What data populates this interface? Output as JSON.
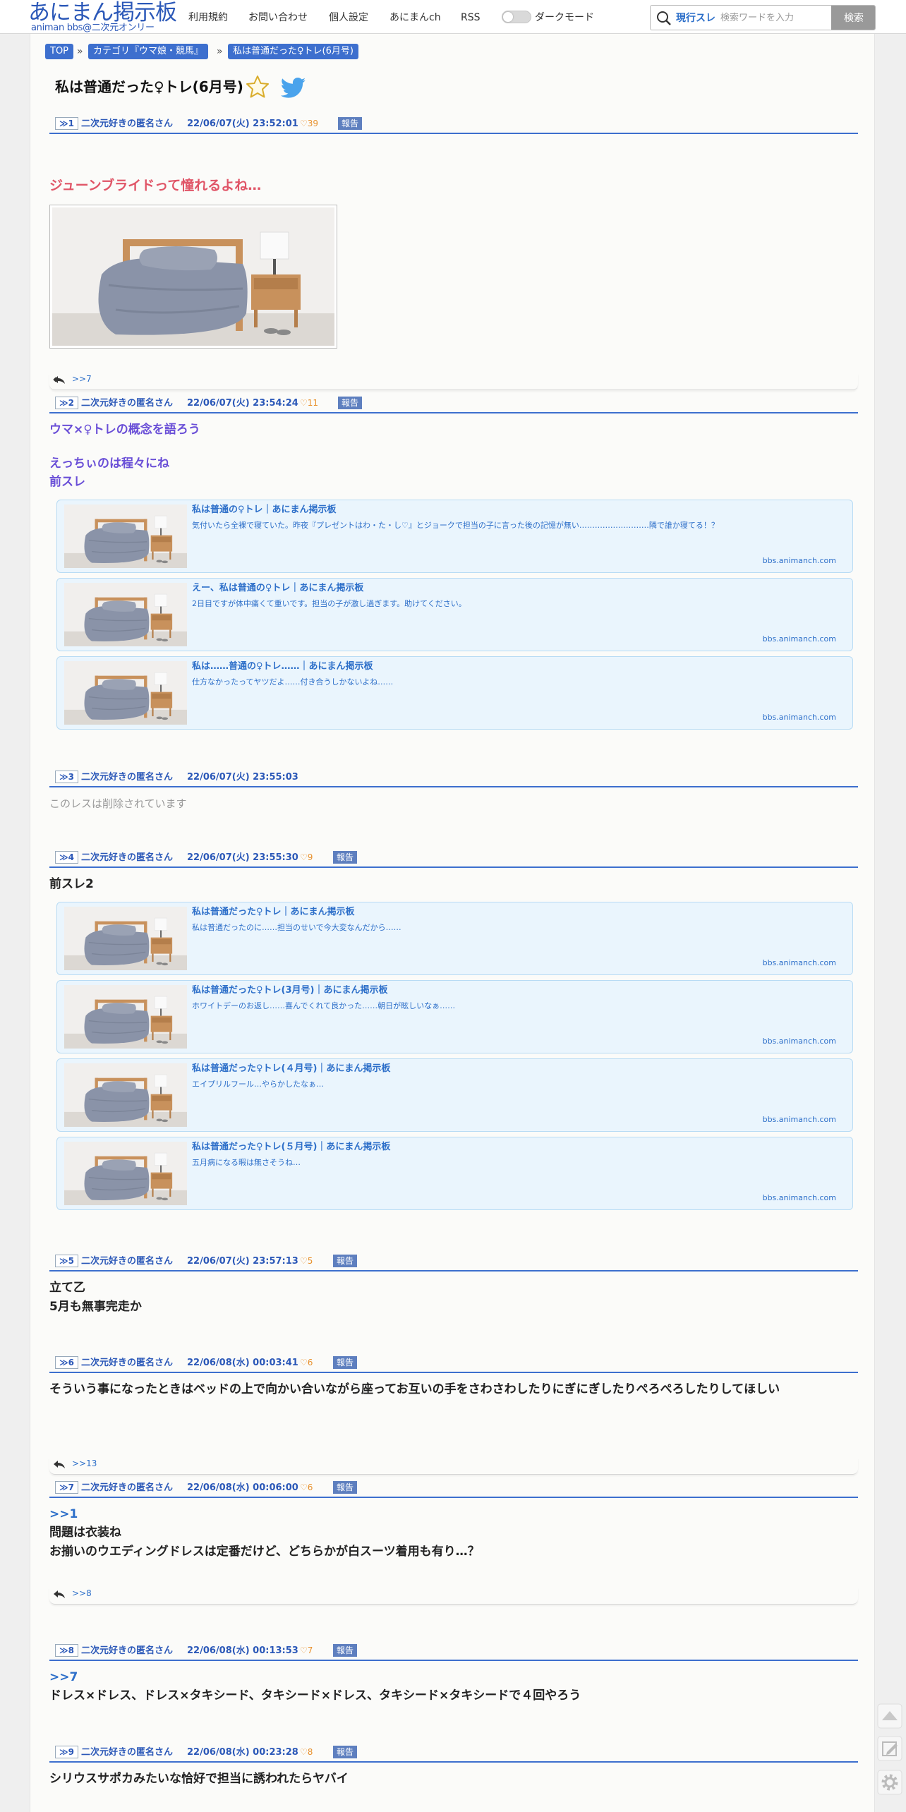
{
  "header": {
    "logo_main": "あにまん掲示板",
    "logo_sub": "animan bbs@二次元オンリー",
    "nav": [
      "利用規約",
      "お問い合わせ",
      "個人設定",
      "あにまんch",
      "RSS"
    ],
    "dark_mode_label": "ダークモード",
    "search_scope": "現行スレ",
    "search_placeholder": "検索ワードを入力",
    "search_button": "検索"
  },
  "breadcrumb": {
    "top": "TOP",
    "category": "カテゴリ『ウマ娘・競馬』",
    "thread": "私は普通だった♀トレ(6月号)",
    "separator": "»"
  },
  "thread_title": "私は普通だった♀トレ(6月号)",
  "colors": {
    "accent": "#3d6fce",
    "link": "#2d6fc9",
    "red": "#e05567",
    "purple": "#6a4fd7",
    "like": "#e8912d"
  },
  "report_label": "報告",
  "posts": [
    {
      "num": "≫1",
      "name": "二次元好きの匿名さん",
      "date": "22/06/07(火) 23:52:01",
      "likes": "39",
      "lines": [
        "ジューンブライドって憧れるよね…"
      ],
      "reply": ">>7"
    },
    {
      "num": "≫2",
      "name": "二次元好きの匿名さん",
      "date": "22/06/07(火) 23:54:24",
      "likes": "11",
      "lines": [
        "ウマ×♀トレの概念を語ろう",
        "えっちぃのは程々にね",
        "前スレ"
      ],
      "cards": [
        {
          "title": "私は普通の♀トレ｜あにまん掲示板",
          "desc": "気付いたら全裸で寝ていた。昨夜『プレゼントはわ・た・し♡』とジョークで担当の子に言った後の記憶が無い………………………隣で誰か寝てる！？",
          "domain": "bbs.animanch.com"
        },
        {
          "title": "えー、私は普通の♀トレ｜あにまん掲示板",
          "desc": "2日目ですが体中痛くて重いです。担当の子が激し過ぎます。助けてください。",
          "domain": "bbs.animanch.com"
        },
        {
          "title": "私は……普通の♀トレ……｜あにまん掲示板",
          "desc": "仕方なかったってヤツだよ……付き合うしかないよね……",
          "domain": "bbs.animanch.com"
        }
      ]
    },
    {
      "num": "≫3",
      "name": "二次元好きの匿名さん",
      "date": "22/06/07(火) 23:55:03",
      "lines": [
        "このレスは削除されています"
      ]
    },
    {
      "num": "≫4",
      "name": "二次元好きの匿名さん",
      "date": "22/06/07(火) 23:55:30",
      "likes": "9",
      "lines": [
        "前スレ2"
      ],
      "cards": [
        {
          "title": "私は普通だった♀トレ｜あにまん掲示板",
          "desc": "私は普通だったのに……担当のせいで今大変なんだから……",
          "domain": "bbs.animanch.com"
        },
        {
          "title": "私は普通だった♀トレ(3月号)｜あにまん掲示板",
          "desc": "ホワイトデーのお返し……喜んでくれて良かった……朝日が眩しいなぁ……",
          "domain": "bbs.animanch.com"
        },
        {
          "title": "私は普通だった♀トレ(４月号)｜あにまん掲示板",
          "desc": "エイプリルフール…やらかしたなぁ…",
          "domain": "bbs.animanch.com"
        },
        {
          "title": "私は普通だった♀トレ(５月号)｜あにまん掲示板",
          "desc": "五月病になる暇は無さそうね…",
          "domain": "bbs.animanch.com"
        }
      ]
    },
    {
      "num": "≫5",
      "name": "二次元好きの匿名さん",
      "date": "22/06/07(火) 23:57:13",
      "likes": "5",
      "lines": [
        "立て乙",
        "5月も無事完走か"
      ]
    },
    {
      "num": "≫6",
      "name": "二次元好きの匿名さん",
      "date": "22/06/08(水) 00:03:41",
      "likes": "6",
      "lines": [
        "そういう事になったときはベッドの上で向かい合いながら座ってお互いの手をさわさわしたりにぎにぎしたりぺろぺろしたりしてほしい"
      ],
      "reply": ">>13"
    },
    {
      "num": "≫7",
      "name": "二次元好きの匿名さん",
      "date": "22/06/08(水) 00:06:00",
      "likes": "6",
      "lines": [
        ">>1",
        "問題は衣装ね",
        "お揃いのウエディングドレスは定番だけど、どちらかが白スーツ着用も有り…？"
      ],
      "reply": ">>8"
    },
    {
      "num": "≫8",
      "name": "二次元好きの匿名さん",
      "date": "22/06/08(水) 00:13:53",
      "likes": "7",
      "lines": [
        ">>7",
        "ドレス×ドレス、ドレス×タキシード、タキシード×ドレス、タキシード×タキシードで４回やろう"
      ]
    },
    {
      "num": "≫9",
      "name": "二次元好きの匿名さん",
      "date": "22/06/08(水) 00:23:28",
      "likes": "8",
      "lines": [
        "シリウスサポカみたいな恰好で担当に誘われたらヤバイ"
      ]
    }
  ]
}
